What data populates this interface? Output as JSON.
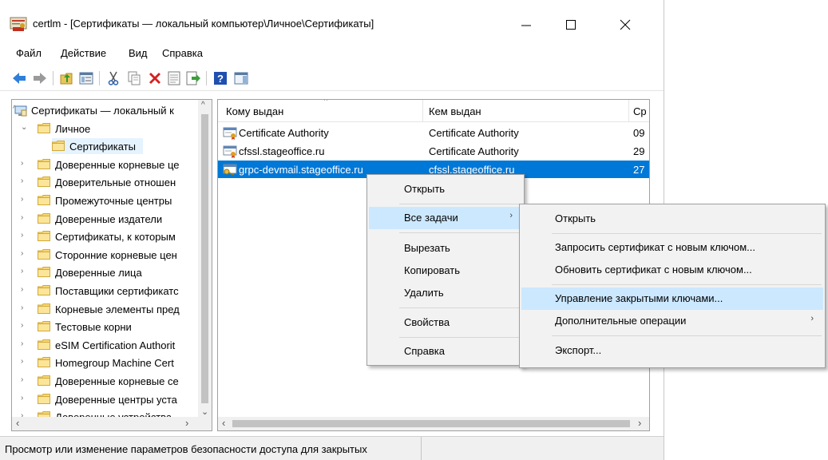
{
  "window": {
    "title": "certlm - [Сертификаты — локальный компьютер\\Личное\\Сертификаты]",
    "controls": {
      "minimize": "—",
      "maximize": "☐",
      "close": "✕"
    }
  },
  "menubar": [
    "Файл",
    "Действие",
    "Вид",
    "Справка"
  ],
  "toolbar": {
    "icons": [
      "back-icon",
      "forward-icon",
      "up-folder-icon",
      "show-hide-tree-icon",
      "cut-icon",
      "copy-icon",
      "delete-icon",
      "properties-icon",
      "export-icon",
      "help-icon",
      "action-pane-icon"
    ]
  },
  "tree": {
    "items": [
      {
        "label": "Сертификаты — локальный к",
        "level": 0,
        "expander": "^",
        "icon": "computer-cert-icon"
      },
      {
        "label": "Личное",
        "level": 1,
        "expander": "⌄",
        "icon": "folder-icon"
      },
      {
        "label": "Сертификаты",
        "level": 2,
        "expander": "",
        "icon": "folder-icon",
        "selected": true
      },
      {
        "label": "Доверенные корневые це",
        "level": 1,
        "expander": "›",
        "icon": "folder-icon"
      },
      {
        "label": "Доверительные отношен",
        "level": 1,
        "expander": "›",
        "icon": "folder-icon"
      },
      {
        "label": "Промежуточные центры",
        "level": 1,
        "expander": "›",
        "icon": "folder-icon"
      },
      {
        "label": "Доверенные издатели",
        "level": 1,
        "expander": "›",
        "icon": "folder-icon"
      },
      {
        "label": "Сертификаты, к которым",
        "level": 1,
        "expander": "›",
        "icon": "folder-icon"
      },
      {
        "label": "Сторонние корневые цен",
        "level": 1,
        "expander": "›",
        "icon": "folder-icon"
      },
      {
        "label": "Доверенные лица",
        "level": 1,
        "expander": "›",
        "icon": "folder-icon"
      },
      {
        "label": "Поставщики сертификатс",
        "level": 1,
        "expander": "›",
        "icon": "folder-icon"
      },
      {
        "label": "Корневые элементы пред",
        "level": 1,
        "expander": "›",
        "icon": "folder-icon"
      },
      {
        "label": "Тестовые корни",
        "level": 1,
        "expander": "›",
        "icon": "folder-icon"
      },
      {
        "label": "eSIM Certification Authorit",
        "level": 1,
        "expander": "›",
        "icon": "folder-icon"
      },
      {
        "label": "Homegroup Machine Cert",
        "level": 1,
        "expander": "›",
        "icon": "folder-icon"
      },
      {
        "label": "Доверенные корневые се",
        "level": 1,
        "expander": "›",
        "icon": "folder-icon"
      },
      {
        "label": "Доверенные центры уста",
        "level": 1,
        "expander": "›",
        "icon": "folder-icon"
      },
      {
        "label": "Доверенные устройства",
        "level": 1,
        "expander": "›",
        "icon": "folder-icon"
      }
    ],
    "scroll_left": "‹",
    "scroll_right": "›",
    "scroll_down": "⌄"
  },
  "list": {
    "columns": [
      "Кому выдан",
      "Кем выдан",
      "Ср"
    ],
    "rows": [
      {
        "issued_to": "Certificate Authority",
        "issued_by": "Certificate Authority",
        "date": "09",
        "icon": "certificate-icon"
      },
      {
        "issued_to": "cfssl.stageoffice.ru",
        "issued_by": "Certificate Authority",
        "date": "29",
        "icon": "certificate-icon"
      },
      {
        "issued_to": "grpc-devmail.stageoffice.ru",
        "issued_by": "cfssl.stageoffice.ru",
        "date": "27",
        "icon": "certificate-key-icon",
        "selected": true
      }
    ],
    "scroll_left": "‹",
    "scroll_right": "›"
  },
  "context_menu": {
    "items": [
      "Открыть",
      "Все задачи",
      "Вырезать",
      "Копировать",
      "Удалить",
      "Свойства",
      "Справка"
    ],
    "arrow": "›"
  },
  "submenu": {
    "items": [
      "Открыть",
      "Запросить сертификат с новым ключом...",
      "Обновить сертификат с новым ключом...",
      "Управление закрытыми ключами...",
      "Дополнительные операции",
      "Экспорт..."
    ],
    "arrow": "›"
  },
  "status": "Просмотр или изменение параметров безопасности доступа для закрытых",
  "colors": {
    "selection": "#0078d7",
    "menu_highlight": "#cce8ff",
    "tree_selection": "#e5f3ff"
  }
}
